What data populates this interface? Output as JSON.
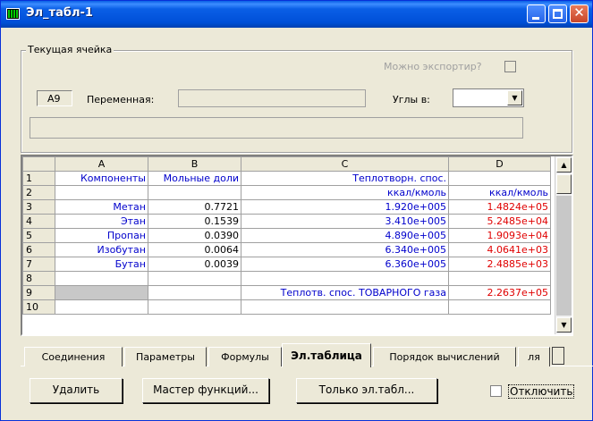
{
  "window": {
    "title": "Эл_табл-1"
  },
  "current_cell": {
    "legend": "Текущая ячейка",
    "export_label": "Можно экспортир?",
    "cell_ref": "A9",
    "variable_label": "Переменная:",
    "angles_label": "Углы в:",
    "angles_value": ""
  },
  "grid": {
    "columns": [
      "A",
      "B",
      "C",
      "D"
    ],
    "rows": [
      {
        "n": "1",
        "a": "Компоненты",
        "b": "Мольные доли",
        "c": "Теплотворн. спос.",
        "d": ""
      },
      {
        "n": "2",
        "a": "",
        "b": "",
        "c": "ккал/кмоль",
        "d": "ккал/кмоль"
      },
      {
        "n": "3",
        "a": "Метан",
        "b": "0.7721",
        "c": "1.920e+005",
        "d": "1.4824e+05"
      },
      {
        "n": "4",
        "a": "Этан",
        "b": "0.1539",
        "c": "3.410e+005",
        "d": "5.2485e+04"
      },
      {
        "n": "5",
        "a": "Пропан",
        "b": "0.0390",
        "c": "4.890e+005",
        "d": "1.9093e+04"
      },
      {
        "n": "6",
        "a": "Изобутан",
        "b": "0.0064",
        "c": "6.340e+005",
        "d": "4.0641e+03"
      },
      {
        "n": "7",
        "a": "Бутан",
        "b": "0.0039",
        "c": "6.360e+005",
        "d": "2.4885e+03"
      },
      {
        "n": "8",
        "a": "",
        "b": "",
        "c": "",
        "d": ""
      },
      {
        "n": "9",
        "a": "",
        "b": "",
        "c": "Теплотв. спос. ТОВАРНОГО газа",
        "d": "2.2637e+05"
      },
      {
        "n": "10",
        "a": "",
        "b": "",
        "c": "",
        "d": ""
      }
    ]
  },
  "tabs": [
    "Соединения",
    "Параметры",
    "Формулы",
    "Эл.таблица",
    "Порядок вычислений",
    "ля"
  ],
  "buttons": {
    "delete": "Удалить",
    "wizard": "Мастер функций...",
    "only_sheet": "Только эл.табл...",
    "disable": "Отключить"
  }
}
